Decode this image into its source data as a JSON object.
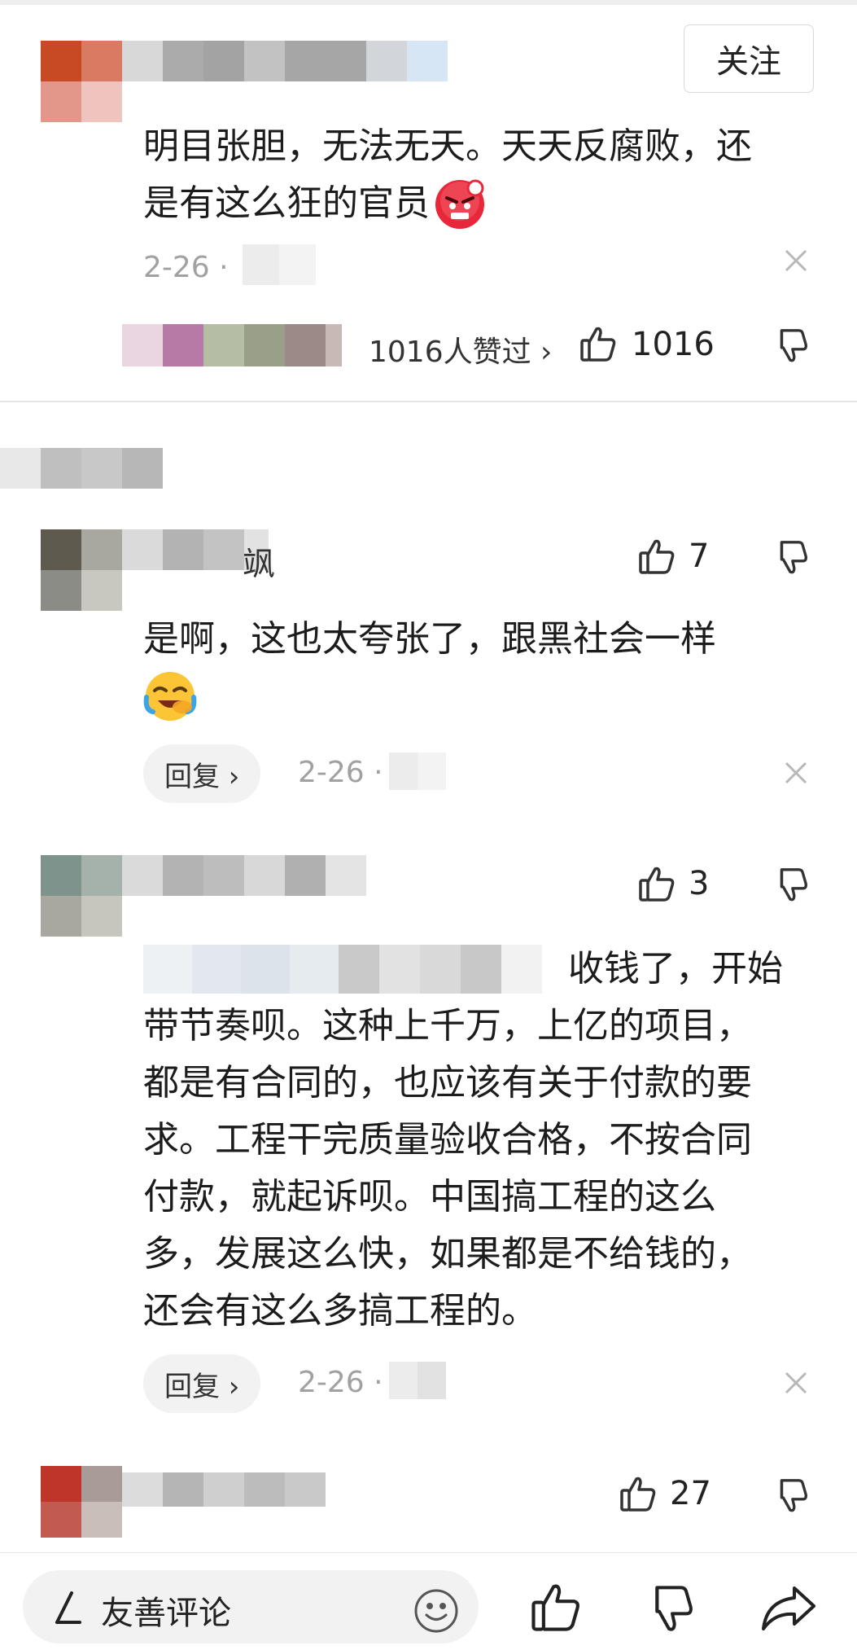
{
  "header": {
    "follow_label": "关注"
  },
  "comments": [
    {
      "text_line1": "明目张胆，无法无天。天天反腐败，还",
      "text_line2": "是有这么狂的官员",
      "emoji": "angry-face-emoji",
      "date": "2-26 ·",
      "likes_summary": "1016人赞过 ›",
      "like_count": "1016"
    },
    {
      "text_line1": "是啊，这也太夸张了，跟黑社会一样",
      "emoji": "laughing-face-emoji",
      "name_suffix": "飒",
      "reply_label": "回复 ›",
      "date": "2-26 ·",
      "like_count": "7"
    },
    {
      "text_line1": "收钱了，开始",
      "text_line2": "带节奏呗。这种上千万，上亿的项目，",
      "text_line3": "都是有合同的，也应该有关于付款的要",
      "text_line4": "求。工程干完质量验收合格，不按合同",
      "text_line5": "付款，就起诉呗。中国搞工程的这么",
      "text_line6": "多，发展这么快，如果都是不给钱的，",
      "text_line7": "还会有这么多搞工程的。",
      "reply_label": "回复 ›",
      "date": "2-26 ·",
      "like_count": "3"
    },
    {
      "like_count": "27"
    }
  ],
  "bottom_bar": {
    "input_placeholder": "友善评论"
  },
  "colors": {
    "text": "#1c1c1c",
    "meta": "#a1a1a1",
    "pill_bg": "#f2f2f2",
    "divider": "#e3e3e3"
  }
}
